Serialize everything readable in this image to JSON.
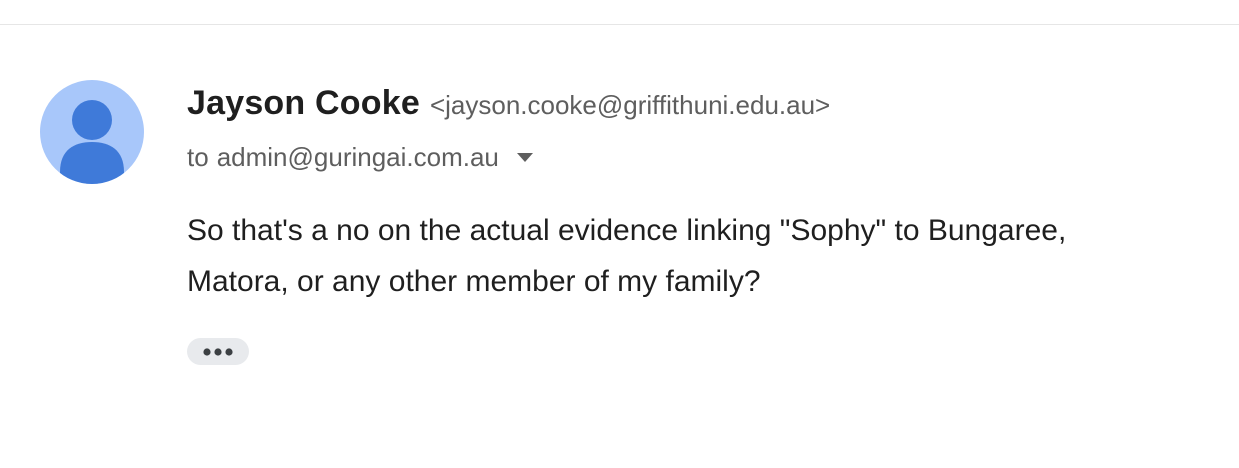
{
  "message": {
    "sender": {
      "name": "Jayson Cooke",
      "email": "<jayson.cooke@griffithuni.edu.au>",
      "avatar_icon": "default-person-avatar-icon"
    },
    "recipient": {
      "prefix": "to",
      "address": "admin@guringai.com.au",
      "dropdown_icon": "caret-down-icon"
    },
    "body": {
      "line1": "So that's a no on the actual evidence linking \"Sophy\" to Bungaree,",
      "line2": "Matora, or any other member of my family?"
    },
    "show_trimmed_icon": "more-horizontal-icon"
  },
  "colors": {
    "avatar_background": "#a8c7fa",
    "avatar_figure": "#3f7ad9",
    "text_primary": "#1f1f1f",
    "text_secondary": "#5e5e5e",
    "chip_background": "#e8eaed"
  }
}
